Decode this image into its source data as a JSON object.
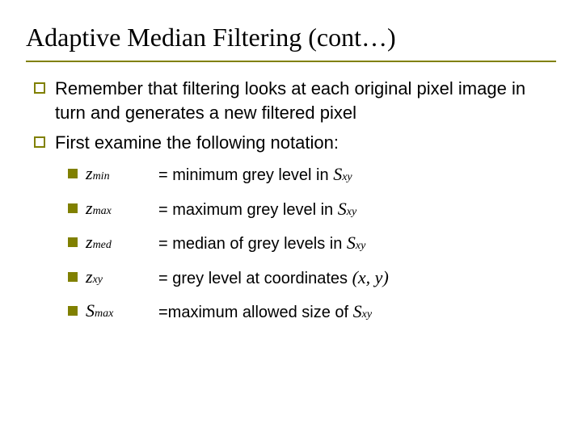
{
  "title": "Adaptive Median Filtering (cont…)",
  "outer": [
    "Remember that filtering looks at each original pixel image in turn and generates a new filtered pixel",
    "First examine the following notation:"
  ],
  "notation": [
    {
      "sym": "z",
      "sub": "min",
      "def_pre": "= minimum grey level in ",
      "def_sym": "S",
      "def_sub": "xy",
      "def_post": ""
    },
    {
      "sym": "z",
      "sub": "max",
      "def_pre": "= maximum grey level in ",
      "def_sym": "S",
      "def_sub": "xy",
      "def_post": ""
    },
    {
      "sym": "z",
      "sub": "med",
      "def_pre": "= median of grey levels in ",
      "def_sym": "S",
      "def_sub": "xy",
      "def_post": ""
    },
    {
      "sym": "z",
      "sub": "xy",
      "def_pre": "= grey level at coordinates ",
      "def_sym": "(x, y)",
      "def_sub": "",
      "def_post": ""
    },
    {
      "sym": "S",
      "sub": "max",
      "def_pre": "=maximum allowed size of ",
      "def_sym": "S",
      "def_sub": "xy",
      "def_post": ""
    }
  ]
}
